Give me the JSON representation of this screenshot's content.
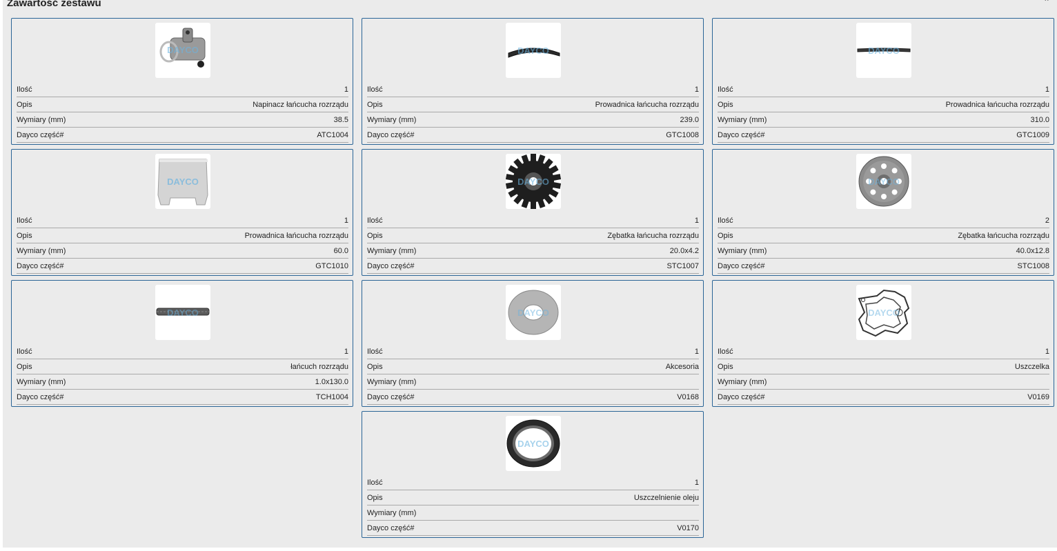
{
  "section": {
    "title": "Zawartość zestawu",
    "collapse_icon": "chevron-up-icon"
  },
  "labels": {
    "qty": "Ilość",
    "desc": "Opis",
    "dims": "Wymiary (mm)",
    "part": "Dayco część#"
  },
  "items": [
    {
      "image": "tensioner-icon",
      "qty": "1",
      "desc": "Napinacz łańcucha rozrządu",
      "dims": "38.5",
      "part": "ATC1004"
    },
    {
      "image": "chain-guide-icon",
      "qty": "1",
      "desc": "Prowadnica łańcucha rozrządu",
      "dims": "239.0",
      "part": "GTC1008"
    },
    {
      "image": "chain-guide-icon",
      "qty": "1",
      "desc": "Prowadnica łańcucha rozrządu",
      "dims": "310.0",
      "part": "GTC1009"
    },
    {
      "image": "guide-block-icon",
      "qty": "1",
      "desc": "Prowadnica łańcucha rozrządu",
      "dims": "60.0",
      "part": "GTC1010"
    },
    {
      "image": "sprocket-icon",
      "qty": "1",
      "desc": "Zębatka łańcucha rozrządu",
      "dims": "20.0x4.2",
      "part": "STC1007"
    },
    {
      "image": "gear-wheel-icon",
      "qty": "2",
      "desc": "Zębatka łańcucha rozrządu",
      "dims": "40.0x12.8",
      "part": "STC1008"
    },
    {
      "image": "timing-chain-icon",
      "qty": "1",
      "desc": "łańcuch rozrządu",
      "dims": "1.0x130.0",
      "part": "TCH1004"
    },
    {
      "image": "washer-icon",
      "qty": "1",
      "desc": "Akcesoria",
      "dims": "",
      "part": "V0168"
    },
    {
      "image": "gasket-icon",
      "qty": "1",
      "desc": "Uszczelka",
      "dims": "",
      "part": "V0169"
    },
    {
      "image": "oil-seal-icon",
      "qty": "1",
      "desc": "Uszczelnienie oleju",
      "dims": "",
      "part": "V0170"
    }
  ],
  "watermark": "DAYCO"
}
